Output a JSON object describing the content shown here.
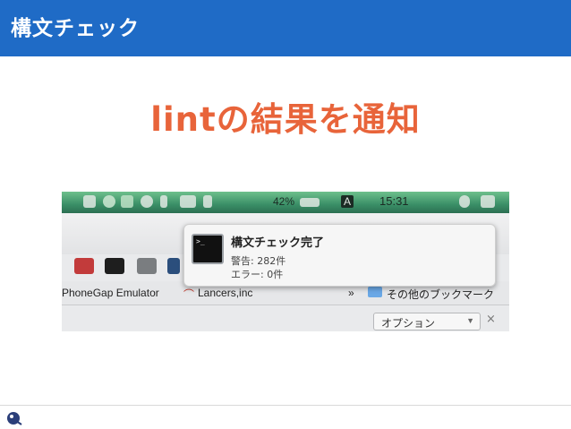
{
  "slide": {
    "title": "構文チェック",
    "headline": "lintの結果を通知"
  },
  "screenshot": {
    "menubar": {
      "battery": "42%",
      "input_indicator": "A",
      "time": "15:31"
    },
    "bookmarks": {
      "item1": "PhoneGap Emulator",
      "item2": "Lancers,inc",
      "more": "»",
      "folder": "その他のブックマーク"
    },
    "options": {
      "label": "オプション",
      "arrow": "▼",
      "close": "×"
    },
    "notification": {
      "icon_prompt": ">_",
      "title": "構文チェック完了",
      "warnings": "警告: 282件",
      "errors": "エラー: 0件"
    }
  }
}
